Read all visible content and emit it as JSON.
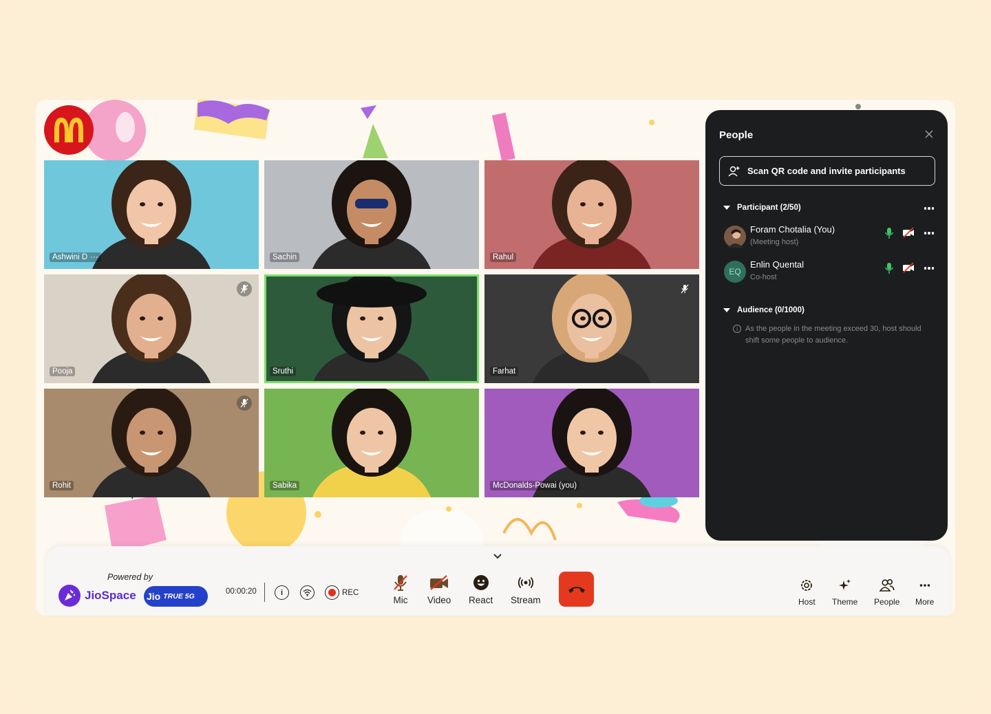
{
  "brand": {
    "logo_letter": "M",
    "logo_color": "#d6161c",
    "logo_fg": "#ffc72c"
  },
  "participants": [
    {
      "name": "Ashwini D",
      "extra": "···",
      "bg": "#6fc7dc",
      "skin": "#f1c6a8",
      "hair": "#3a2518",
      "muted": false,
      "active": false
    },
    {
      "name": "Sachin",
      "extra": "",
      "bg": "#b9bcc0",
      "skin": "#c48b64",
      "hair": "#1b1410",
      "muted": false,
      "active": false
    },
    {
      "name": "Rahul",
      "extra": "",
      "bg": "#c16d6e",
      "skin": "#e7b394",
      "hair": "#3b2417",
      "muted": false,
      "active": false
    },
    {
      "name": "Pooja",
      "extra": "",
      "bg": "#d9d2c7",
      "skin": "#e3b08f",
      "hair": "#4a2e1c",
      "muted": true,
      "active": false
    },
    {
      "name": "Sruthi",
      "extra": "",
      "bg": "#2e5a3c",
      "skin": "#ecc4a4",
      "hair": "#151515",
      "muted": false,
      "active": true
    },
    {
      "name": "Farhat",
      "extra": "",
      "bg": "#3a3a3a",
      "skin": "#eac0a0",
      "hair": "#d8a777",
      "muted": true,
      "active": false
    },
    {
      "name": "Rohit",
      "extra": "",
      "bg": "#a88a6d",
      "skin": "#c99673",
      "hair": "#2a1b12",
      "muted": true,
      "active": false
    },
    {
      "name": "Sabika",
      "extra": "",
      "bg": "#77b552",
      "skin": "#efc6a5",
      "hair": "#1a1410",
      "muted": false,
      "active": false
    },
    {
      "name": "McDonalds-Powai (you)",
      "extra": "",
      "bg": "#a15bbd",
      "skin": "#efc7a7",
      "hair": "#1b1311",
      "muted": false,
      "active": false
    }
  ],
  "panel": {
    "title": "People",
    "invite_label": "Scan QR code and invite participants",
    "participant_section": "Participant (2/50)",
    "members": [
      {
        "name": "Foram Chotalia (You)",
        "role": "(Meeting host)",
        "initials": "",
        "avatar_color": "#6b4a3a"
      },
      {
        "name": "Enlin Quental",
        "role": "Co-host",
        "initials": "EQ",
        "avatar_color": "#2f6f5b"
      }
    ],
    "audience_section": "Audience (0/1000)",
    "audience_notice": "As the people in the meeting exceed 30, host should shift some people to audience."
  },
  "toolbar": {
    "powered_by": "Powered by",
    "jiospace": "JioSpace",
    "jio": "Jio",
    "true5g": "TRUE 5G",
    "timer": "00:00:20",
    "info": "i",
    "rec": "REC",
    "mic": "Mic",
    "video": "Video",
    "react": "React",
    "stream": "Stream",
    "host": "Host",
    "theme": "Theme",
    "people": "People",
    "more": "More"
  },
  "colors": {
    "accent_green": "#7ae06a",
    "mic_green": "#3fc36b",
    "end_call": "#e5391f",
    "panel_bg": "#1c1d1f"
  }
}
